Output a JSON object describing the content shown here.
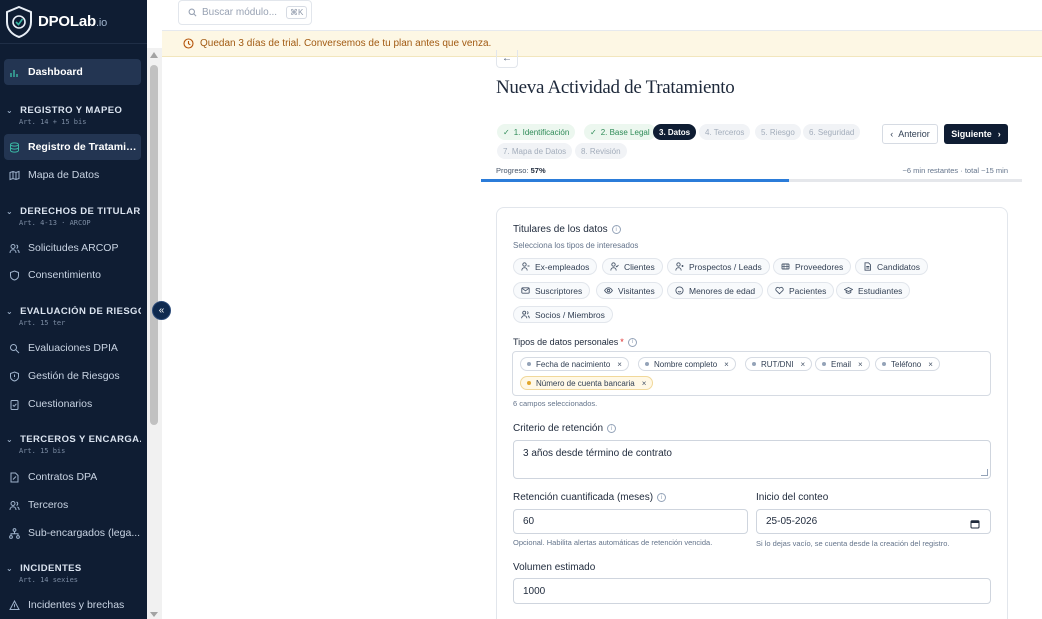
{
  "brand": {
    "name": "DPOLab",
    "suffix": ".io"
  },
  "search": {
    "placeholder": "Buscar módulo...",
    "shortcut": "⌘K"
  },
  "trial_banner": {
    "text": "Quedan 3 días de trial. Conversemos de tu plan antes que venza."
  },
  "sidebar": {
    "dashboard": "Dashboard",
    "sections": [
      {
        "title": "REGISTRO Y MAPEO",
        "subtitle": "Art. 14 + 15 bis",
        "items": [
          "Registro de Tratamient...",
          "Mapa de Datos"
        ]
      },
      {
        "title": "DERECHOS DE TITULAR...",
        "subtitle": "Art. 4-13 · ARCOP",
        "items": [
          "Solicitudes ARCOP",
          "Consentimiento"
        ]
      },
      {
        "title": "EVALUACIÓN DE RIESGO",
        "subtitle": "Art. 15 ter",
        "items": [
          "Evaluaciones DPIA",
          "Gestión de Riesgos",
          "Cuestionarios"
        ]
      },
      {
        "title": "TERCEROS Y ENCARGA...",
        "subtitle": "Art. 15 bis",
        "items": [
          "Contratos DPA",
          "Terceros",
          "Sub-encargados (lega..."
        ]
      },
      {
        "title": "INCIDENTES",
        "subtitle": "Art. 14 sexies",
        "items": [
          "Incidentes y brechas"
        ]
      }
    ]
  },
  "page": {
    "back": "←",
    "title": "Nueva Actividad de Tratamiento"
  },
  "steps": [
    {
      "label": "1. Identificación",
      "status": "done"
    },
    {
      "label": "2. Base Legal",
      "status": "done"
    },
    {
      "label": "3. Datos",
      "status": "current"
    },
    {
      "label": "4. Terceros",
      "status": "pending"
    },
    {
      "label": "5. Riesgo",
      "status": "pending"
    },
    {
      "label": "6. Seguridad",
      "status": "pending"
    },
    {
      "label": "7. Mapa de Datos",
      "status": "pending"
    },
    {
      "label": "8. Revisión",
      "status": "pending"
    }
  ],
  "nav_buttons": {
    "prev": "Anterior",
    "next": "Siguiente"
  },
  "progress": {
    "label": "Progreso:",
    "value_text": "57%",
    "value": 0.57,
    "remaining": "~6 min restantes · total ~15 min"
  },
  "form": {
    "holders": {
      "label": "Titulares de los datos",
      "hint": "Selecciona los tipos de interesados",
      "options": [
        "Ex-empleados",
        "Clientes",
        "Prospectos / Leads",
        "Proveedores",
        "Candidatos",
        "Suscriptores",
        "Visitantes",
        "Menores de edad",
        "Pacientes",
        "Estudiantes",
        "Socios / Miembros"
      ]
    },
    "data_types": {
      "label": "Tipos de datos personales",
      "required": "*",
      "tags": [
        "Fecha de nacimiento",
        "Nombre completo",
        "RUT/DNI",
        "Email",
        "Teléfono",
        "Número de cuenta bancaria"
      ],
      "count_text": "6 campos seleccionados."
    },
    "retention": {
      "label": "Criterio de retención",
      "value": "3 años desde término de contrato"
    },
    "retention_months": {
      "label": "Retención cuantificada (meses)",
      "value": "60",
      "hint": "Opcional. Habilita alertas automáticas de retención vencida."
    },
    "start": {
      "label": "Inicio del conteo",
      "value": "25-05-2026",
      "hint": "Si lo dejas vacío, se cuenta desde la creación del registro."
    },
    "volume": {
      "label": "Volumen estimado",
      "value": "1000"
    }
  },
  "colors": {
    "sidebar_bg": "#0f1d33",
    "accent": "#2b7cd9",
    "done": "#2e8b57",
    "warning": "#a15a12"
  }
}
